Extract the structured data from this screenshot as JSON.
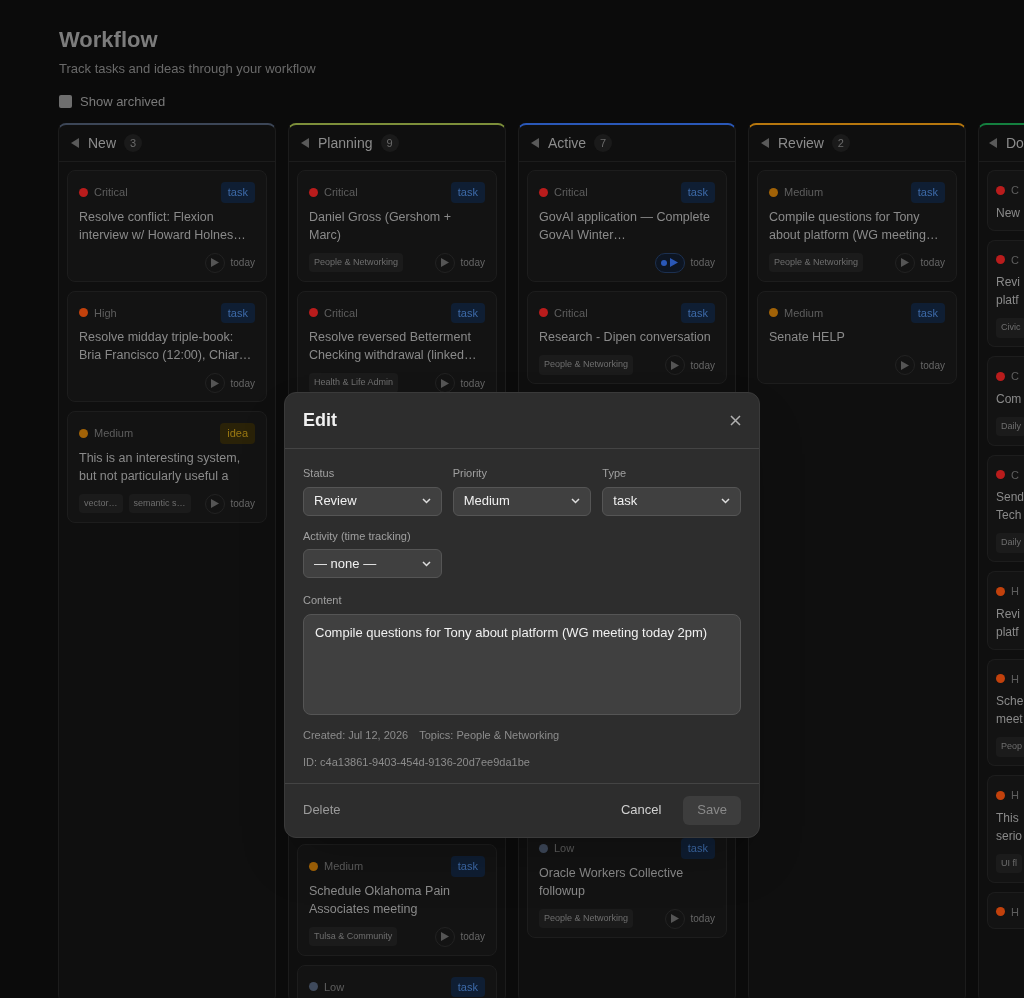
{
  "header": {
    "title": "Workflow",
    "subtitle": "Track tasks and ideas through your workflow",
    "show_archived": {
      "label": "Show archived",
      "checked": false
    }
  },
  "columns": [
    {
      "title": "New",
      "count": "3",
      "color": "#3c4657",
      "cards": [
        {
          "kind": "card",
          "priority": "Critical",
          "color": "#b91c1c",
          "type": "task",
          "title": "Resolve conflict: Flexion interview w/ Howard Holnes…",
          "due": "today",
          "timer_running": false
        },
        {
          "kind": "card",
          "priority": "High",
          "color": "#c2410c",
          "type": "task",
          "title": "Resolve midday triple-book: Bria Francisco (12:00), Chiar…",
          "due": "today",
          "timer_running": false
        },
        {
          "kind": "card",
          "priority": "Medium",
          "color": "#a16207",
          "type": "idea",
          "title": "This is an interesting system, but not particularly useful a",
          "tags": [
            "vector…",
            "semantic s…"
          ],
          "due": "today",
          "timer_running": false
        }
      ]
    },
    {
      "title": "Planning",
      "count": "9",
      "color": "#7d8f3a",
      "cards": [
        {
          "kind": "card",
          "priority": "Critical",
          "color": "#b91c1c",
          "type": "task",
          "title": "Daniel Gross (Gershom + Marc)",
          "tags": [
            "People & Networking"
          ],
          "due": "today",
          "timer_running": false
        },
        {
          "kind": "card",
          "priority": "Critical",
          "color": "#b91c1c",
          "type": "task",
          "title": "Resolve reversed Betterment Checking withdrawal (linked…",
          "tags": [
            "Health & Life Admin"
          ],
          "due": "today",
          "timer_running": false
        },
        {
          "kind": "covered"
        },
        {
          "kind": "card",
          "priority": "Medium",
          "color": "#a16207",
          "type": "task",
          "title": "Schedule Oklahoma Pain Associates meeting",
          "tags": [
            "Tulsa & Community"
          ],
          "due": "today",
          "timer_running": false
        },
        {
          "kind": "card",
          "priority": "Low",
          "color": "#3f4a5c",
          "type": "task"
        }
      ]
    },
    {
      "title": "Active",
      "count": "7",
      "color": "#2a58b8",
      "cards": [
        {
          "kind": "card",
          "priority": "Critical",
          "color": "#b91c1c",
          "type": "task",
          "title": "GovAI application — Complete GovAI Winter…",
          "due": "today",
          "timer_running": true
        },
        {
          "kind": "card",
          "priority": "Critical",
          "color": "#b91c1c",
          "type": "task",
          "title": "Research - Dipen conversation",
          "tags": [
            "People & Networking"
          ],
          "due": "today",
          "timer_running": false
        },
        {
          "kind": "covered"
        },
        {
          "kind": "card",
          "priority": "Low",
          "color": "#3f4a5c",
          "type": "task",
          "title": "Oracle Workers Collective followup",
          "tags": [
            "People & Networking"
          ],
          "due": "today",
          "timer_running": false
        }
      ]
    },
    {
      "title": "Review",
      "count": "2",
      "color": "#b7770e",
      "cards": [
        {
          "kind": "card",
          "priority": "Medium",
          "color": "#a16207",
          "type": "task",
          "title": "Compile questions for Tony about platform (WG meeting…",
          "tags": [
            "People & Networking"
          ],
          "due": "today",
          "timer_running": false
        },
        {
          "kind": "card",
          "priority": "Medium",
          "color": "#a16207",
          "type": "task",
          "title": "Senate HELP",
          "due": "today",
          "timer_running": false
        }
      ]
    },
    {
      "title": "Do",
      "color": "#14803f",
      "cards": [
        {
          "kind": "card",
          "priority": "C",
          "color": "#b91c1c",
          "title": "New"
        },
        {
          "kind": "card",
          "priority": "C",
          "color": "#b91c1c",
          "title": "Revi\nplatf",
          "tags": [
            "Civic"
          ]
        },
        {
          "kind": "card",
          "priority": "C",
          "color": "#b91c1c",
          "title": "Com",
          "tags": [
            "Daily"
          ]
        },
        {
          "kind": "card",
          "priority": "C",
          "color": "#b91c1c",
          "title": "Send\nTech",
          "tags": [
            "Daily"
          ]
        },
        {
          "kind": "card",
          "priority": "H",
          "color": "#c2410c",
          "title": "Revi\nplatf"
        },
        {
          "kind": "card",
          "priority": "H",
          "color": "#c2410c",
          "title": "Sche\nmeet",
          "tags": [
            "Peop"
          ]
        },
        {
          "kind": "card",
          "priority": "H",
          "color": "#c2410c",
          "title": "This\nserio",
          "tags": [
            "UI fl"
          ]
        },
        {
          "kind": "card",
          "priority": "H",
          "color": "#c2410c"
        }
      ]
    }
  ],
  "modal": {
    "title": "Edit",
    "fields": [
      {
        "label": "Status",
        "value": "Review"
      },
      {
        "label": "Priority",
        "value": "Medium"
      },
      {
        "label": "Type",
        "value": "task"
      },
      {
        "label": "Activity (time tracking)",
        "value": "— none —"
      }
    ],
    "content": {
      "label": "Content",
      "value": "Compile questions for Tony about platform (WG meeting today 2pm)"
    },
    "created": "Created: Jul 12, 2026",
    "topics": "Topics: People & Networking",
    "id": "ID: c4a13861-9403-454d-9136-20d7ee9da1be",
    "delete": "Delete",
    "cancel": "Cancel",
    "save": {
      "label": "Save",
      "disabled": true
    }
  }
}
